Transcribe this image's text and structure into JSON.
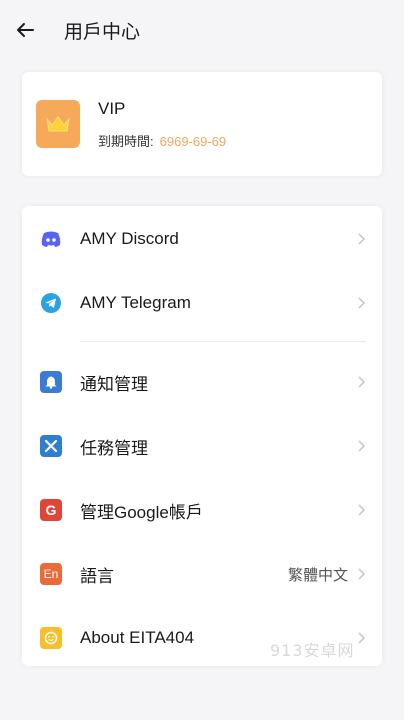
{
  "header": {
    "title": "用戶中心"
  },
  "vip": {
    "title": "VIP",
    "expiry_label": "到期時間:",
    "expiry_date": "6969-69-69"
  },
  "menu": {
    "discord": {
      "label": "AMY Discord",
      "icon": "discord-icon",
      "color": "#5865f2"
    },
    "telegram": {
      "label": "AMY Telegram",
      "icon": "telegram-icon",
      "color": "#2aa3e0"
    },
    "notifications": {
      "label": "通知管理",
      "icon": "bell-icon",
      "color": "#3a7bd5"
    },
    "tasks": {
      "label": "任務管理",
      "icon": "tools-icon",
      "color": "#2f7fd1"
    },
    "google": {
      "label": "管理Google帳戶",
      "icon": "google-icon",
      "color": "#e0453a"
    },
    "language": {
      "label": "語言",
      "value": "繁體中文",
      "icon": "language-icon",
      "icon_text": "En",
      "color": "#ea6a3a"
    },
    "about": {
      "label": "About EITA404",
      "icon": "smiley-icon",
      "color": "#f6c02a"
    }
  },
  "watermark": "913安卓网"
}
